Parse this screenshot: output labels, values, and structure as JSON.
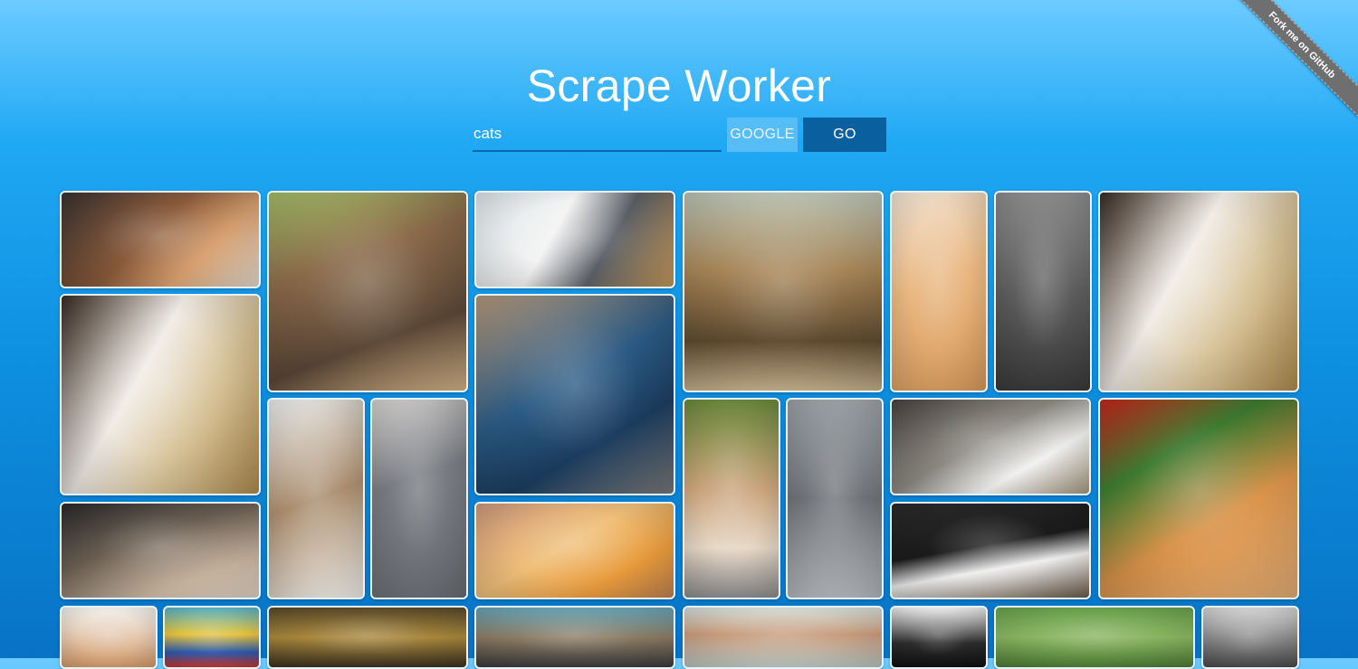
{
  "header": {
    "title": "Scrape Worker"
  },
  "search": {
    "value": "cats",
    "placeholder": ""
  },
  "buttons": {
    "google_label": "GOOGLE",
    "go_label": "GO"
  },
  "ribbon": {
    "label": "Fork me on GitHub"
  },
  "colors": {
    "background_top": "#6ccbff",
    "background_bottom": "#0873c6",
    "go_button": "#0a5f9e",
    "google_button": "#56bdf6",
    "tile_border": "#e6f4ff"
  },
  "gallery": {
    "images": [
      {
        "subject": "kittens-cuddling"
      },
      {
        "subject": "fluffy-brown-cat"
      },
      {
        "subject": "tabby-white-cat"
      },
      {
        "subject": "bengal-cat"
      },
      {
        "subject": "ginger-cat-sleeping"
      },
      {
        "subject": "grey-cat-with-kitten"
      },
      {
        "subject": "persian-calico-cat"
      },
      {
        "subject": "white-grey-kitten"
      },
      {
        "subject": "man-holding-cat"
      },
      {
        "subject": "fluffy-kitten"
      },
      {
        "subject": "grey-cat-rainbow"
      },
      {
        "subject": "orange-kitten-walking"
      },
      {
        "subject": "grey-cat-with-toy-mouse"
      },
      {
        "subject": "tabby-cat-face"
      },
      {
        "subject": "cat-under-christmas-tree"
      },
      {
        "subject": "kitten-big-eyes"
      },
      {
        "subject": "ginger-cat-lying"
      },
      {
        "subject": "black-white-cat"
      },
      {
        "subject": "kitten-partial"
      },
      {
        "subject": "cat-propeller-hat"
      },
      {
        "subject": "cat-eyes-closeup"
      },
      {
        "subject": "tabby-kitten-partial"
      },
      {
        "subject": "person-with-cat"
      },
      {
        "subject": "black-cat-partial"
      },
      {
        "subject": "cat-in-grass"
      },
      {
        "subject": "grey-tabby-partial"
      }
    ]
  }
}
